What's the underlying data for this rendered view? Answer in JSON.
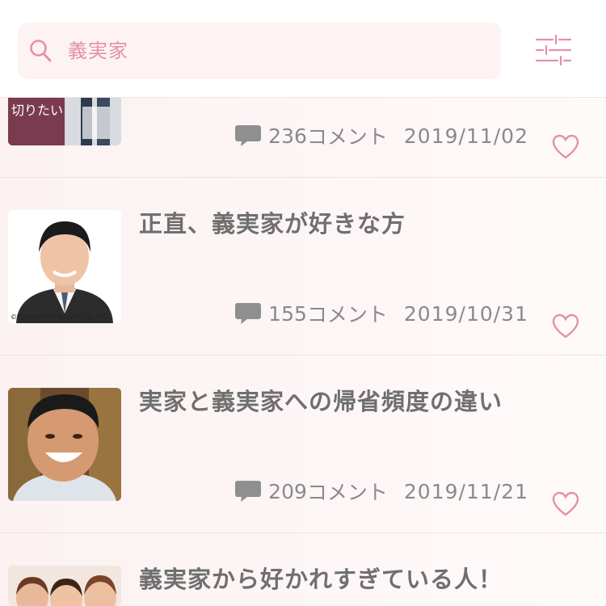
{
  "search": {
    "query": "義実家"
  },
  "articles": [
    {
      "title": "",
      "comments": "236",
      "comment_suffix": "コメント",
      "date": "2019/11/02",
      "thumb_caption": "切りたい"
    },
    {
      "title": "正直、義実家が好きな方",
      "comments": "155",
      "comment_suffix": "コメント",
      "date": "2019/10/31",
      "thumb_caption": "©YOSHIMOTO KOGYO CO.,LTD."
    },
    {
      "title": "実家と義実家への帰省頻度の違い",
      "comments": "209",
      "comment_suffix": "コメント",
      "date": "2019/11/21"
    },
    {
      "title": "義実家から好かれすぎている人！"
    }
  ],
  "icons": [
    "search-icon",
    "filter-icon",
    "comment-icon",
    "heart-icon"
  ],
  "colors": {
    "accent": "#e590a6",
    "text": "#6f6f6f",
    "meta": "#8a8a8a",
    "row_bg": "#fcf2f2"
  }
}
